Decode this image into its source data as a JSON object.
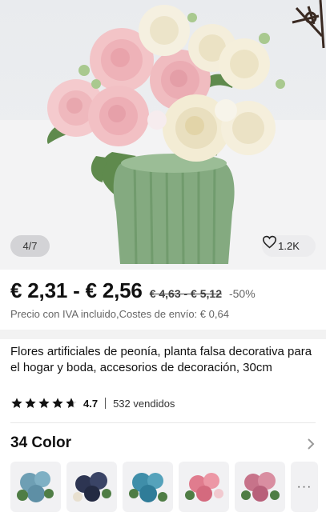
{
  "gallery": {
    "page_indicator": "4/7",
    "likes": "1.2K",
    "like_icon": "heart-outline-icon"
  },
  "price": {
    "current": "€ 2,31 - € 2,56",
    "original": "€ 4,63 - € 5,12",
    "discount": "-50%",
    "tax_shipping": "Precio con IVA incluido,Costes de envío: € 0,64"
  },
  "product": {
    "title": "Flores artificiales de peonía, planta falsa decorativa para el hogar y boda, accesorios de decoración, 30cm",
    "rating": "4.7",
    "rating_stars": 4.7,
    "sold": "532 vendidos"
  },
  "variants": {
    "heading": "34 Color",
    "more_label": "···",
    "swatches": [
      {
        "name": "light-blue",
        "color": "#6e9fb4"
      },
      {
        "name": "dark-navy",
        "color": "#2d3552"
      },
      {
        "name": "teal-blue",
        "color": "#3f8ea9"
      },
      {
        "name": "pink",
        "color": "#e07c8e"
      },
      {
        "name": "rose-mauve",
        "color": "#c7738a"
      }
    ]
  },
  "colors": {
    "vase": "#7fa67b",
    "peony_pink": "#f2c3c6",
    "peony_cream": "#f3ecd6",
    "star": "#111111"
  }
}
